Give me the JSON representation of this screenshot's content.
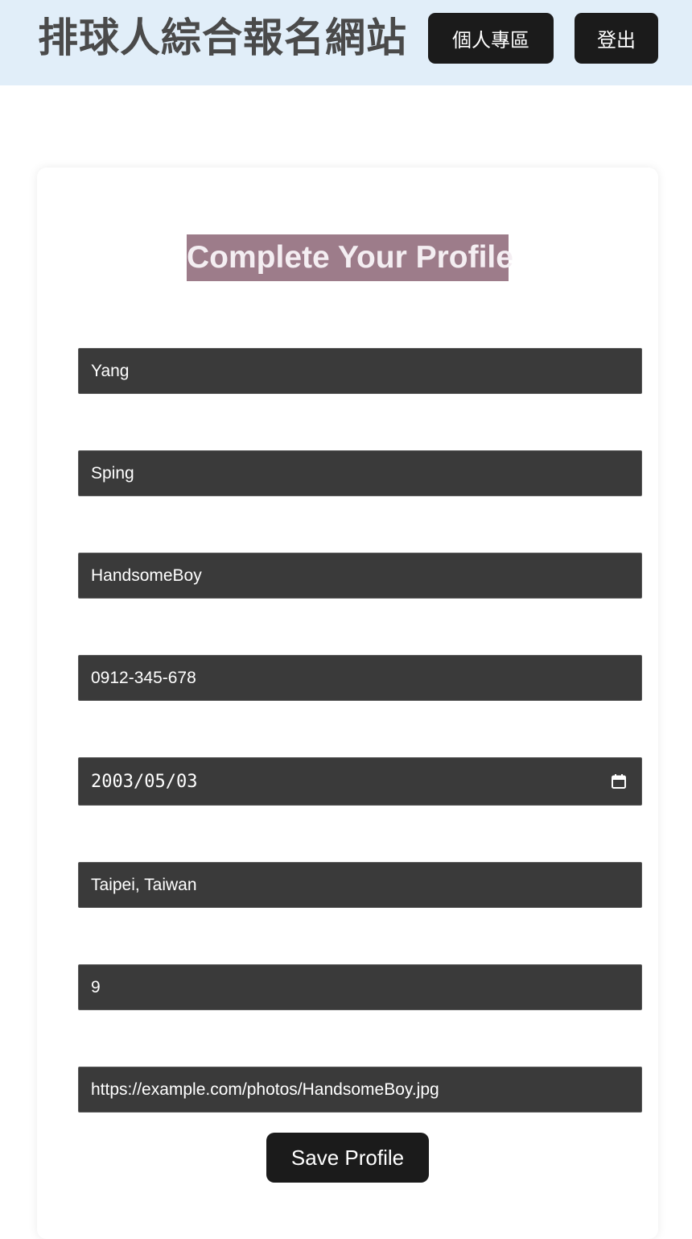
{
  "header": {
    "site_title": "排球人綜合報名網站",
    "profile_button": "個人專區",
    "logout_button": "登出"
  },
  "form": {
    "title": "Complete Your Profile",
    "fields": [
      {
        "name": "last-name",
        "value": "Yang"
      },
      {
        "name": "first-name",
        "value": "Sping"
      },
      {
        "name": "nickname",
        "value": "HandsomeBoy"
      },
      {
        "name": "phone",
        "value": "0912-345-678"
      },
      {
        "name": "birthdate",
        "value": "2003/05/03",
        "icon": "calendar-icon"
      },
      {
        "name": "location",
        "value": "Taipei, Taiwan"
      },
      {
        "name": "number",
        "value": "9"
      },
      {
        "name": "photo-url",
        "value": "https://example.com/photos/HandsomeBoy.jpg"
      }
    ],
    "save_button": "Save Profile"
  },
  "colors": {
    "header_bg": "#e1eef9",
    "button_bg": "#1b1b1b",
    "title_highlight": "#9d7c8a",
    "input_bg": "#3a3a3a"
  }
}
